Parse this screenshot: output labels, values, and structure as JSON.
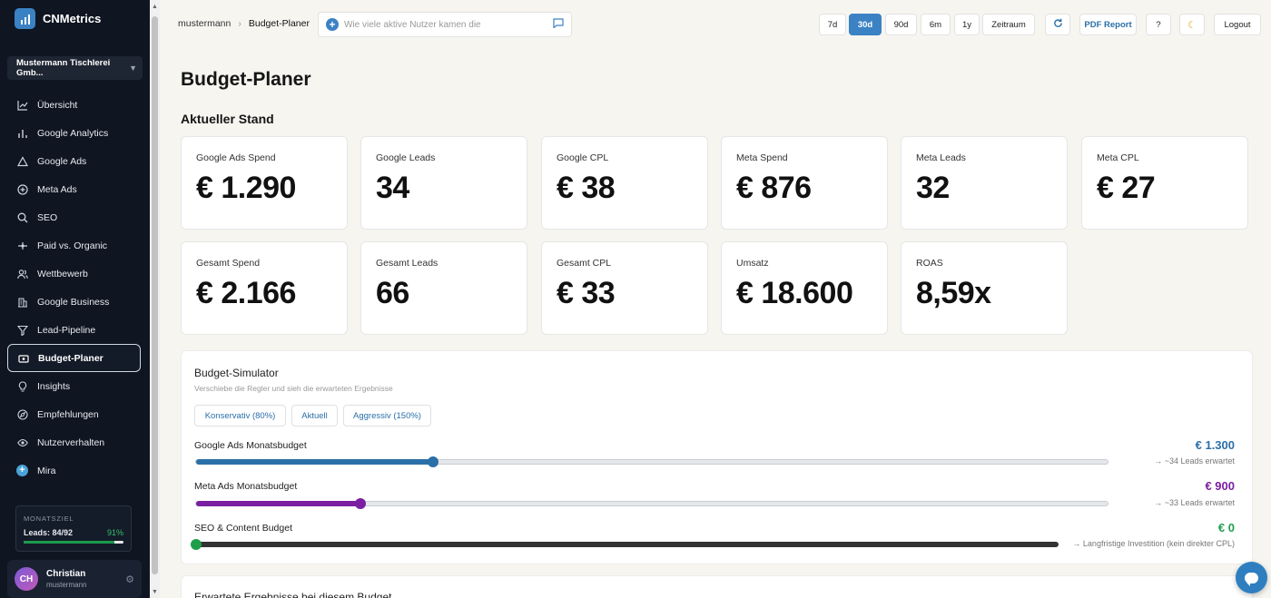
{
  "app": {
    "name": "CNMetrics"
  },
  "sidebar": {
    "organization": "Mustermann Tischlerei Gmb...",
    "items": [
      {
        "label": "Übersicht",
        "icon": "chart-line-icon"
      },
      {
        "label": "Google Analytics",
        "icon": "bar-chart-icon"
      },
      {
        "label": "Google Ads",
        "icon": "triangle-icon"
      },
      {
        "label": "Meta Ads",
        "icon": "plus-circle-icon"
      },
      {
        "label": "SEO",
        "icon": "search-icon"
      },
      {
        "label": "Paid vs. Organic",
        "icon": "split-icon"
      },
      {
        "label": "Wettbewerb",
        "icon": "users-icon"
      },
      {
        "label": "Google Business",
        "icon": "building-icon"
      },
      {
        "label": "Lead-Pipeline",
        "icon": "funnel-icon"
      },
      {
        "label": "Budget-Planer",
        "icon": "wallet-icon",
        "active": true
      },
      {
        "label": "Insights",
        "icon": "lightbulb-icon"
      },
      {
        "label": "Empfehlungen",
        "icon": "compass-icon"
      },
      {
        "label": "Nutzerverhalten",
        "icon": "eye-icon"
      },
      {
        "label": "Mira",
        "icon": "mira-plus-icon"
      }
    ],
    "goal": {
      "title": "MONATSZIEL",
      "label": "Leads: 84/92",
      "percent": "91%",
      "progress": 0.91
    },
    "user": {
      "initials": "CH",
      "name": "Christian",
      "username": "mustermann"
    }
  },
  "header": {
    "breadcrumb": {
      "root": "mustermann",
      "current": "Budget-Planer"
    },
    "ask_placeholder": "Wie viele aktive Nutzer kamen die",
    "ranges": [
      "7d",
      "30d",
      "90d",
      "6m",
      "1y",
      "Zeitraum"
    ],
    "active_range": "30d",
    "pdf_label": "PDF Report",
    "help_label": "?",
    "logout_label": "Logout"
  },
  "page": {
    "title": "Budget-Planer",
    "section": "Aktueller Stand",
    "kpis": [
      {
        "label": "Google Ads Spend",
        "value": "€ 1.290"
      },
      {
        "label": "Google Leads",
        "value": "34"
      },
      {
        "label": "Google CPL",
        "value": "€ 38"
      },
      {
        "label": "Meta Spend",
        "value": "€ 876"
      },
      {
        "label": "Meta Leads",
        "value": "32"
      },
      {
        "label": "Meta CPL",
        "value": "€ 27"
      },
      {
        "label": "Gesamt Spend",
        "value": "€ 2.166"
      },
      {
        "label": "Gesamt Leads",
        "value": "66"
      },
      {
        "label": "Gesamt CPL",
        "value": "€ 33"
      },
      {
        "label": "Umsatz",
        "value": "€ 18.600"
      },
      {
        "label": "ROAS",
        "value": "8,59x"
      }
    ]
  },
  "simulator": {
    "title": "Budget-Simulator",
    "subtitle": "Verschiebe die Regler und sieh die erwarteten Ergebnisse",
    "presets": [
      "Konservativ (80%)",
      "Aktuell",
      "Aggressiv (150%)"
    ],
    "sliders": [
      {
        "label": "Google Ads Monatsbudget",
        "value": "€ 1.300",
        "note": "→ ~34 Leads erwartet",
        "fraction": 0.26,
        "color": "#2a6fa8"
      },
      {
        "label": "Meta Ads Monatsbudget",
        "value": "€ 900",
        "note": "→ ~33 Leads erwartet",
        "fraction": 0.18,
        "color": "#7a1fa2"
      },
      {
        "label": "SEO & Content Budget",
        "value": "€ 0",
        "note": "→ Langfristige Investition (kein direkter CPL)",
        "fraction": 0.0,
        "color": "#1e9e4a"
      }
    ]
  },
  "expected": {
    "title": "Erwartete Ergebnisse bei diesem Budget"
  }
}
